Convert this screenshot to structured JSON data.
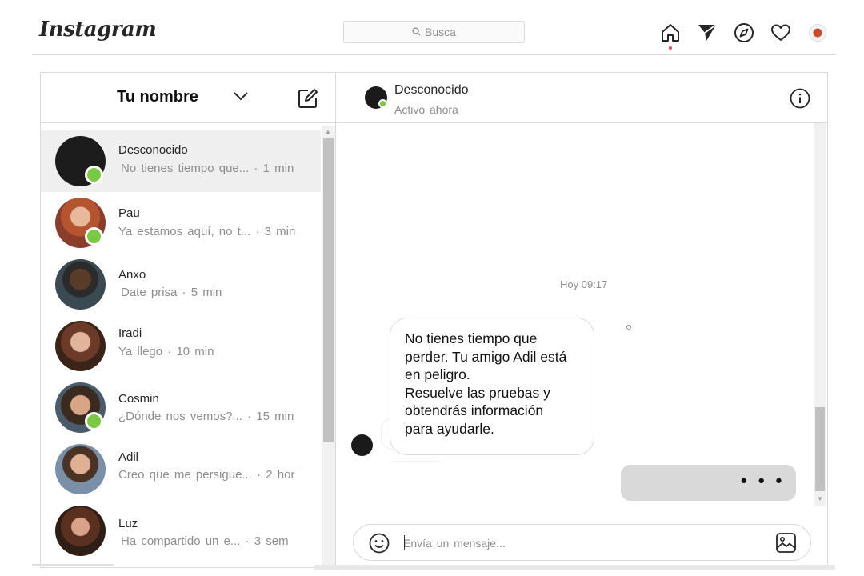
{
  "topbar": {
    "logo": "Instagram",
    "search_placeholder": "Busca",
    "icons": [
      "home-icon",
      "direct-icon",
      "explore-icon",
      "heart-icon",
      "profile-avatar"
    ]
  },
  "sidebar": {
    "username": "Tu nombre",
    "conversations": [
      {
        "name": "Desconocido",
        "preview": "No tienes tiempo que...",
        "time": "1 min",
        "online": true,
        "active": true
      },
      {
        "name": "Pau",
        "preview": "Ya estamos aquí, no t...",
        "time": "3 min",
        "online": true,
        "active": false
      },
      {
        "name": "Anxo",
        "preview": "Date prisa",
        "time": "5 min",
        "online": false,
        "active": false
      },
      {
        "name": "Iradi",
        "preview": "Ya llego",
        "time": "10 min",
        "online": false,
        "active": false
      },
      {
        "name": "Cosmin",
        "preview": "¿Dónde nos vemos?...",
        "time": "15 min",
        "online": true,
        "active": false
      },
      {
        "name": "Adil",
        "preview": "Creo que me persigue...",
        "time": "2 hor",
        "online": false,
        "active": false
      },
      {
        "name": "Luz",
        "preview": "Ha compartido un e...",
        "time": "3 sem",
        "online": false,
        "active": false
      }
    ]
  },
  "chat": {
    "contact_name": "Desconocido",
    "contact_status": "Activo ahora",
    "timestamp": "Hoy 09:17",
    "message_lines": [
      "No tienes tiempo que",
      "perder. Tu amigo Adil está",
      "en peligro.",
      "Resuelve las pruebas y",
      "obtendrás información",
      "para ayudarle."
    ],
    "typing_indicator": "• • •",
    "input_placeholder": "Envía un mensaje..."
  },
  "colors": {
    "online": "#7ac943",
    "border": "#dbdbdb",
    "muted_text": "#8e8e8e",
    "active_row": "#efefef",
    "typing_bubble": "#d9d9d9",
    "notification_dot": "#ed4956"
  }
}
